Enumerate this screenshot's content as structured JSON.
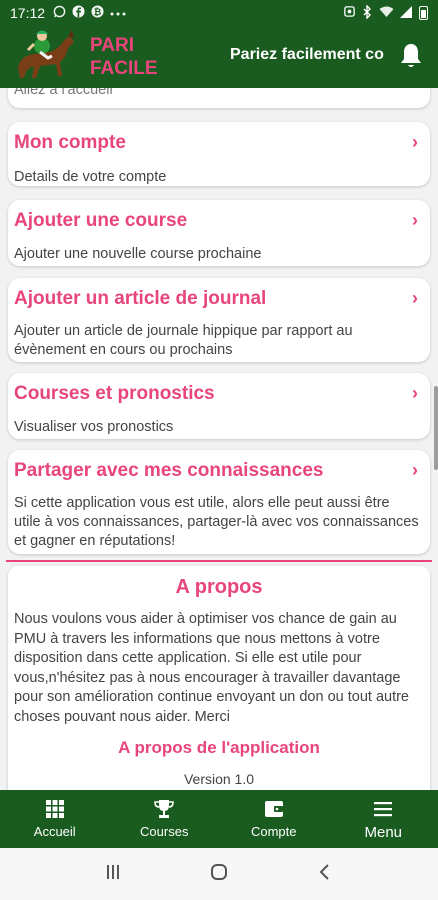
{
  "status_bar": {
    "time": "17:12",
    "left_icons": [
      "whatsapp-icon",
      "facebook-icon",
      "bitcoin-icon",
      "more-dots-icon"
    ],
    "right_icons": [
      "alarm-icon",
      "bluetooth-icon",
      "wifi-icon",
      "signal-icon",
      "battery-icon"
    ]
  },
  "app_bar": {
    "brand_line1": "PARI",
    "brand_line2": "FACILE",
    "tagline": "Pariez facilement co",
    "colors": {
      "primary": "#1a5c20",
      "accent": "#e8457d"
    }
  },
  "menu": {
    "cut_item_desc": "Allez à l'accueil",
    "items": [
      {
        "title": "Mon compte",
        "desc": "Details de votre compte"
      },
      {
        "title": "Ajouter une course",
        "desc": "Ajouter une nouvelle course prochaine"
      },
      {
        "title": "Ajouter un article de journal",
        "desc": "Ajouter un article de journale hippique par rapport au évènement en cours ou prochains"
      },
      {
        "title": "Courses et pronostics",
        "desc": "Visualiser vos pronostics"
      },
      {
        "title": "Partager avec mes connaissances",
        "desc": "Si cette application vous est utile, alors elle peut aussi être utile à vos connaissances, partager-là avec vos connaissances et gagner en réputations!"
      }
    ],
    "chevron": "›"
  },
  "about": {
    "heading": "A propos",
    "text": "Nous voulons vous aider à optimiser vos chance de gain au PMU à travers les informations que nous mettons à votre disposition dans cette application. Si elle est utile pour vous,n'hésitez pas à nous encourager à travailler davantage pour son amélioration continue envoyant un don ou tout autre choses pouvant nous aider. Merci",
    "app_heading": "A propos de l'application",
    "version": "Version 1.0"
  },
  "bottom_nav": [
    {
      "label": "Accueil",
      "icon": "grid-icon"
    },
    {
      "label": "Courses",
      "icon": "trophy-icon"
    },
    {
      "label": "Compte",
      "icon": "wallet-icon"
    },
    {
      "label": "Menu",
      "icon": "hamburger-icon"
    }
  ]
}
